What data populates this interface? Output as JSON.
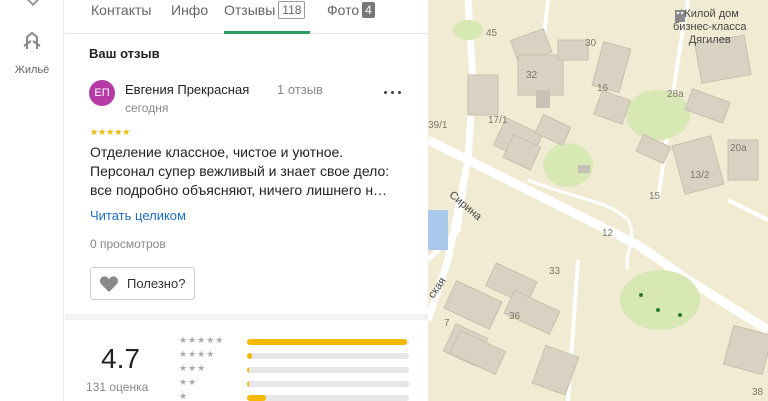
{
  "rail": {
    "item_label": "Жильё"
  },
  "tabs": [
    {
      "label": "Контакты"
    },
    {
      "label": "Инфо"
    },
    {
      "label": "Отзывы",
      "badge": "118"
    },
    {
      "label": "Фото",
      "badge": "4"
    }
  ],
  "review": {
    "section_title": "Ваш отзыв",
    "avatar_initials": "ЕП",
    "author": "Евгения Прекрасная",
    "author_reviews": "1 отзыв",
    "date": "сегодня",
    "stars": "★★★★★",
    "rating_value": 5,
    "text_lines": [
      "Отделение классное, чистое и уютное.",
      "Персонал супер вежливый и знает свое дело:",
      "все подробно объясняют, ничего лишнего н…"
    ],
    "read_more": "Читать целиком",
    "views": "0 просмотров",
    "useful_label": "Полезно?"
  },
  "rating": {
    "value": "4.7",
    "count": "131 оценка",
    "bars": [
      {
        "stars": "★★★★★",
        "fraction": 0.99
      },
      {
        "stars": "★★★★",
        "fraction": 0.03
      },
      {
        "stars": "★★★",
        "fraction": 0.01
      },
      {
        "stars": "★★",
        "fraction": 0.01
      },
      {
        "stars": "★",
        "fraction": 0.12
      }
    ]
  },
  "map": {
    "poi_label": "Жилой дом\nбизнес-класса\nДягилев",
    "streets": [
      "Сирина",
      "ская"
    ],
    "house_numbers": [
      "45",
      "30",
      "32",
      "16",
      "28а",
      "20а",
      "39/1",
      "17/1",
      "13/2",
      "15",
      "12",
      "33",
      "36",
      "7",
      "38"
    ]
  },
  "colors": {
    "accent_green": "#2b9e5f",
    "star_yellow": "#f5b800",
    "link_blue": "#1a6fc9",
    "avatar_purple": "#b53aa5"
  }
}
